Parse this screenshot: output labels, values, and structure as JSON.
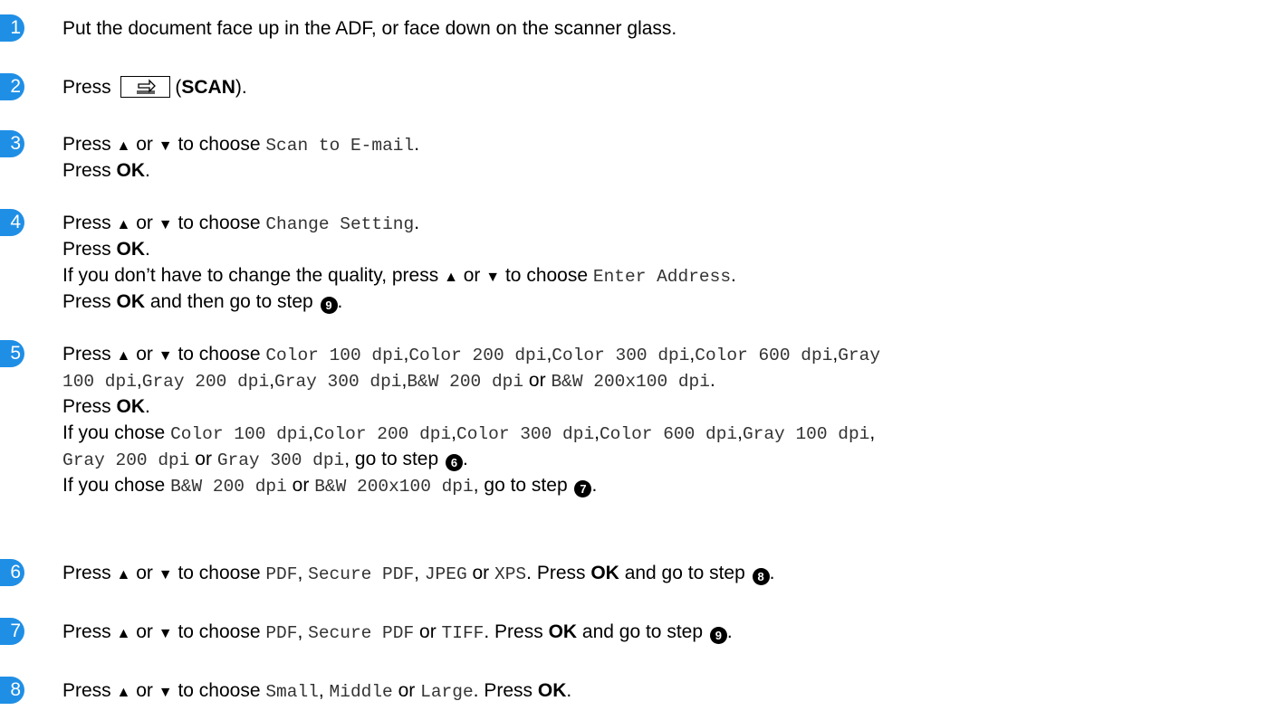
{
  "steps": [
    {
      "num": "1",
      "text1": "Put the document face up in the ADF, or face down on the scanner glass."
    },
    {
      "num": "2",
      "press": "Press",
      "scan_label": "SCAN"
    },
    {
      "num": "3",
      "p": "Press",
      "up": "▲",
      "or": "or",
      "down": "▼",
      "to_choose": "to choose",
      "option": "Scan to E-mail",
      "press_ok_a": "Press",
      "ok": "OK"
    },
    {
      "num": "4",
      "p": "Press",
      "up": "▲",
      "or": "or",
      "down": "▼",
      "to_choose": "to choose",
      "option": "Change Setting",
      "press_ok_a": "Press",
      "ok": "OK",
      "line3_a": "If you don’t have to change the quality, press",
      "line3_opt": "Enter Address",
      "line4_a": "Press",
      "line4_b": "and then go to step",
      "ref": "9"
    },
    {
      "num": "5",
      "p": "Press",
      "up": "▲",
      "or": "or",
      "down": "▼",
      "to_choose": "to choose",
      "opts": [
        "Color 100 dpi",
        "Color 200 dpi",
        "Color 300 dpi",
        "Color 600 dpi",
        "Gray 100 dpi",
        "Gray 200 dpi",
        "Gray 300 dpi",
        "B&W 200 dpi",
        "B&W 200x100 dpi"
      ],
      "opt4_l1": "Gray",
      "opt4_l2": "100 dpi",
      "ok": "OK",
      "if_chose": "If you chose",
      "go_to_step": "go to step",
      "ref6": "6",
      "ref7": "7"
    },
    {
      "num": "6",
      "p": "Press",
      "up": "▲",
      "or": "or",
      "down": "▼",
      "to_choose": "to choose",
      "opts": [
        "PDF",
        "Secure PDF",
        "JPEG",
        "XPS"
      ],
      "press": "Press",
      "ok": "OK",
      "and_go": "and go to step",
      "ref": "8"
    },
    {
      "num": "7",
      "p": "Press",
      "up": "▲",
      "or": "or",
      "down": "▼",
      "to_choose": "to choose",
      "opts": [
        "PDF",
        "Secure PDF",
        "TIFF"
      ],
      "press": "Press",
      "ok": "OK",
      "and_go": "and go to step",
      "ref": "9"
    },
    {
      "num": "8",
      "p": "Press",
      "up": "▲",
      "or": "or",
      "down": "▼",
      "to_choose": "to choose",
      "opts": [
        "Small",
        "Middle",
        "Large"
      ],
      "press": "Press",
      "ok": "OK"
    }
  ],
  "colors": {
    "badge": "#1f8fe6",
    "mono_text": "#333333"
  },
  "icons": {
    "scan_key": "scan-key-icon",
    "step_ref": "circled-number-icon"
  }
}
